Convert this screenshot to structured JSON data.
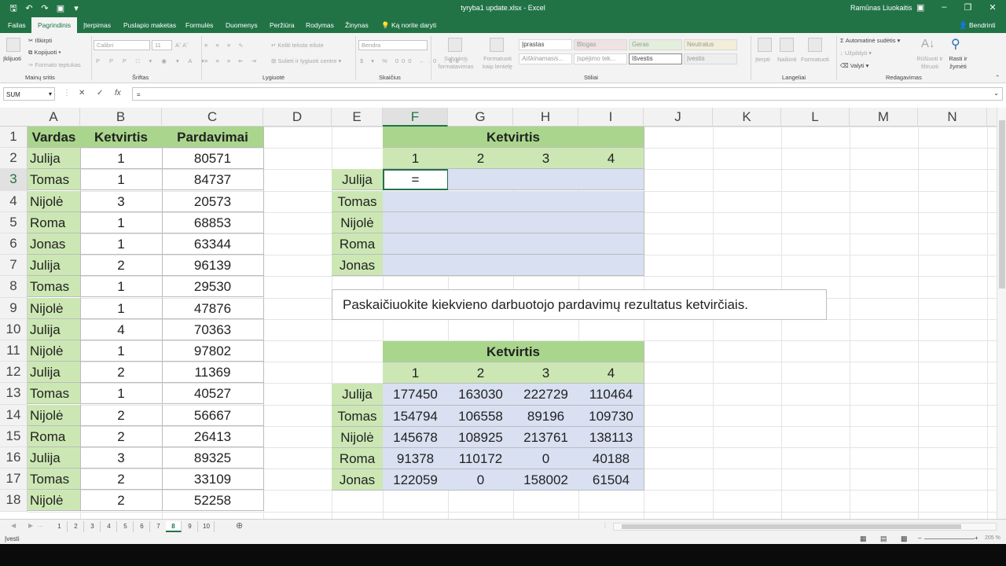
{
  "app": {
    "doc_title": "tyryba1 update.xlsx - Excel",
    "user": "Ramūnas Liuokaitis",
    "share_label": "Bendrinti"
  },
  "tabs": [
    "Failas",
    "Pagrindinis",
    "Įterpimas",
    "Puslapio maketas",
    "Formulės",
    "Duomenys",
    "Peržiūra",
    "Rodymas",
    "Žinynas"
  ],
  "tell_me": "Ką norite daryti",
  "ribbon": {
    "clipboard": {
      "paste": "Įklijuoti",
      "cut": "Iškirpti",
      "copy": "Kopijuoti",
      "format_painter": "Formato teptukas",
      "group": "Mainų sritis"
    },
    "font": {
      "name": "Calibri",
      "size": "11",
      "group": "Šriftas"
    },
    "alignment": {
      "wrap": "Keliti teksto eilute",
      "merge": "Sulieti ir lygiuoti centre",
      "group": "Lygiuotė"
    },
    "number": {
      "format": "Bendra",
      "group": "Skaičius"
    },
    "styles": {
      "conditional": "Sąlyginis formatavimas",
      "format_table": "Formatuoti kaip lentelę",
      "cells": [
        "Įprastas",
        "Blogas",
        "Geras",
        "Neutralus",
        "Aiškinamasis...",
        "Įspėjimo tek...",
        "Išvestis",
        "Įvestis"
      ],
      "group": "Stiliai"
    },
    "cells": {
      "insert": "Įterpti",
      "delete": "Naikinti",
      "format": "Formatuoti",
      "group": "Langeliai"
    },
    "editing": {
      "autosum": "Automatinė sudėtis",
      "fill": "Užpildyti",
      "clear": "Valyti",
      "sort": "Rūšiuoti ir filtruoti",
      "find": "Rasti ir žymėti",
      "group": "Redagavimas"
    }
  },
  "formula_bar": {
    "name_box": "SUM",
    "formula": "="
  },
  "columns": [
    "A",
    "B",
    "C",
    "D",
    "E",
    "F",
    "G",
    "H",
    "I",
    "J",
    "K",
    "L",
    "M",
    "N"
  ],
  "rows": [
    "1",
    "2",
    "3",
    "4",
    "5",
    "6",
    "7",
    "8",
    "9",
    "10",
    "11",
    "12",
    "13",
    "14",
    "15",
    "16",
    "17",
    "18"
  ],
  "sales": {
    "headers": [
      "Vardas",
      "Ketvirtis",
      "Pardavimai"
    ],
    "records": [
      [
        "Julija",
        "1",
        "80571"
      ],
      [
        "Tomas",
        "1",
        "84737"
      ],
      [
        "Nijolė",
        "3",
        "20573"
      ],
      [
        "Roma",
        "1",
        "68853"
      ],
      [
        "Jonas",
        "1",
        "63344"
      ],
      [
        "Julija",
        "2",
        "96139"
      ],
      [
        "Tomas",
        "1",
        "29530"
      ],
      [
        "Nijolė",
        "1",
        "47876"
      ],
      [
        "Julija",
        "4",
        "70363"
      ],
      [
        "Nijolė",
        "1",
        "97802"
      ],
      [
        "Julija",
        "2",
        "11369"
      ],
      [
        "Tomas",
        "1",
        "40527"
      ],
      [
        "Nijolė",
        "2",
        "56667"
      ],
      [
        "Roma",
        "2",
        "26413"
      ],
      [
        "Julija",
        "3",
        "89325"
      ],
      [
        "Tomas",
        "2",
        "33109"
      ],
      [
        "Nijolė",
        "2",
        "52258"
      ]
    ]
  },
  "pivot_empty": {
    "title": "Ketvirtis",
    "quarters": [
      "1",
      "2",
      "3",
      "4"
    ],
    "names": [
      "Julija",
      "Tomas",
      "Nijolė",
      "Roma",
      "Jonas"
    ],
    "active_value": "="
  },
  "task_note": "Paskaičiuokite kiekvieno darbuotojo pardavimų rezultatus ketvirčiais.",
  "pivot_result": {
    "title": "Ketvirtis",
    "quarters": [
      "1",
      "2",
      "3",
      "4"
    ],
    "rows": [
      {
        "name": "Julija",
        "values": [
          "177450",
          "163030",
          "222729",
          "110464"
        ]
      },
      {
        "name": "Tomas",
        "values": [
          "154794",
          "106558",
          "89196",
          "109730"
        ]
      },
      {
        "name": "Nijolė",
        "values": [
          "145678",
          "108925",
          "213761",
          "138113"
        ]
      },
      {
        "name": "Roma",
        "values": [
          "91378",
          "110172",
          "0",
          "40188"
        ]
      },
      {
        "name": "Jonas",
        "values": [
          "122059",
          "0",
          "158002",
          "61504"
        ]
      }
    ]
  },
  "sheet_tabs": [
    "1",
    "2",
    "3",
    "4",
    "5",
    "6",
    "7",
    "8",
    "9",
    "10"
  ],
  "active_sheet": "8",
  "status": {
    "mode": "Įvesti",
    "zoom": "205 %"
  }
}
